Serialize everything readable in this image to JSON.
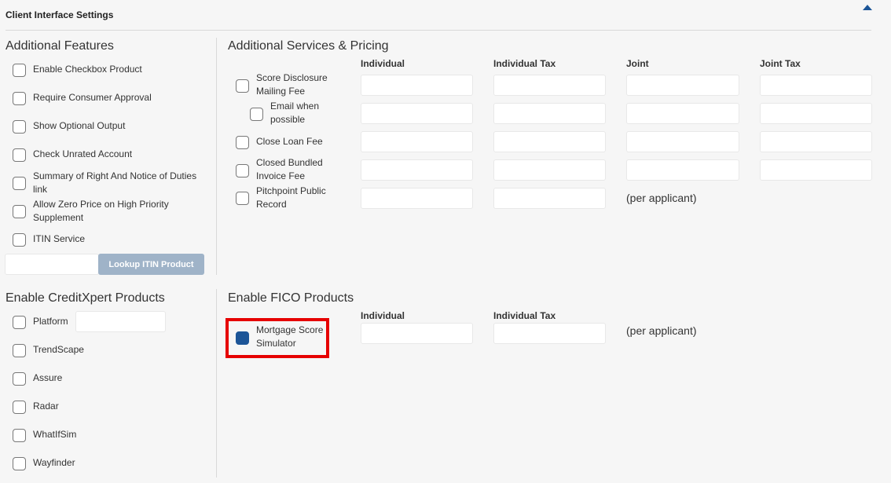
{
  "header": {
    "title": "Client Interface Settings"
  },
  "additional_features": {
    "title": "Additional Features",
    "items": [
      "Enable Checkbox Product",
      "Require Consumer Approval",
      "Show Optional Output",
      "Check Unrated Account",
      "Summary of Right And Notice of Duties link",
      "Allow Zero Price on High Priority Supplement",
      "ITIN Service"
    ],
    "lookup_button": "Lookup ITIN Product"
  },
  "services": {
    "title": "Additional Services & Pricing",
    "columns": [
      "Individual",
      "Individual Tax",
      "Joint",
      "Joint Tax"
    ],
    "rows": [
      "Score Disclosure Mailing Fee",
      "Email when possible",
      "Close Loan Fee",
      "Closed Bundled Invoice Fee",
      "Pitchpoint Public Record"
    ],
    "per_applicant": "(per applicant)"
  },
  "creditxpert": {
    "title": "Enable CreditXpert Products",
    "items": [
      "Platform",
      "TrendScape",
      "Assure",
      "Radar",
      "WhatIfSim",
      "Wayfinder"
    ]
  },
  "fico": {
    "title": "Enable FICO Products",
    "columns": [
      "Individual",
      "Individual Tax"
    ],
    "item": "Mortgage Score Simulator",
    "item_checked": true,
    "per_applicant": "(per applicant)"
  }
}
